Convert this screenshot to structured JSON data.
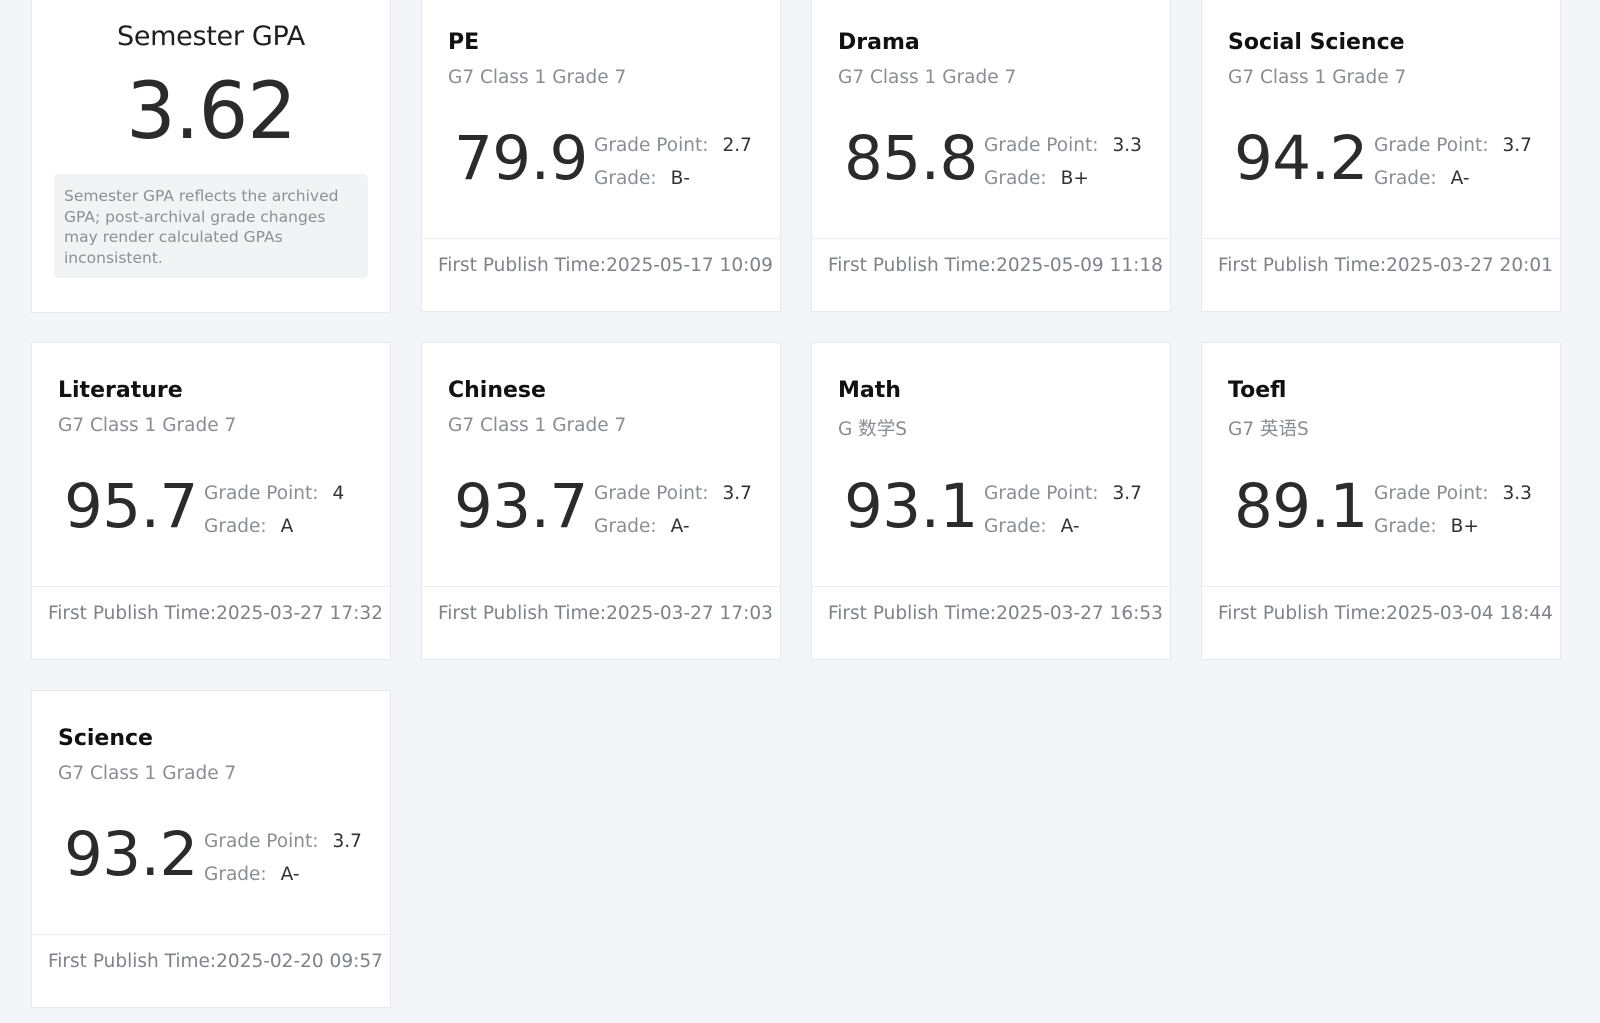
{
  "gpa": {
    "title": "Semester GPA",
    "value": "3.62",
    "note": "Semester GPA reflects the archived GPA; post-archival grade changes may render calculated GPAs inconsistent."
  },
  "labels": {
    "grade_point": "Grade Point:",
    "grade": "Grade:",
    "first_publish": "First Publish Time:"
  },
  "subjects": [
    {
      "name": "PE",
      "class": "G7 Class 1 Grade 7",
      "score": "79.9",
      "grade_point": "2.7",
      "grade": "B-",
      "published": "2025-05-17 10:09"
    },
    {
      "name": "Drama",
      "class": "G7 Class 1 Grade 7",
      "score": "85.8",
      "grade_point": "3.3",
      "grade": "B+",
      "published": "2025-05-09 11:18"
    },
    {
      "name": "Social Science",
      "class": "G7 Class 1 Grade 7",
      "score": "94.2",
      "grade_point": "3.7",
      "grade": "A-",
      "published": "2025-03-27 20:01"
    },
    {
      "name": "Literature",
      "class": "G7 Class 1 Grade 7",
      "score": "95.7",
      "grade_point": "4",
      "grade": "A",
      "published": "2025-03-27 17:32"
    },
    {
      "name": "Chinese",
      "class": "G7 Class 1 Grade 7",
      "score": "93.7",
      "grade_point": "3.7",
      "grade": "A-",
      "published": "2025-03-27 17:03"
    },
    {
      "name": "Math",
      "class": "G 数学S",
      "score": "93.1",
      "grade_point": "3.7",
      "grade": "A-",
      "published": "2025-03-27 16:53"
    },
    {
      "name": "Toefl",
      "class": "G7 英语S",
      "score": "89.1",
      "grade_point": "3.3",
      "grade": "B+",
      "published": "2025-03-04 18:44"
    },
    {
      "name": "Science",
      "class": "G7 Class 1 Grade 7",
      "score": "93.2",
      "grade_point": "3.7",
      "grade": "A-",
      "published": "2025-02-20 09:57"
    }
  ]
}
